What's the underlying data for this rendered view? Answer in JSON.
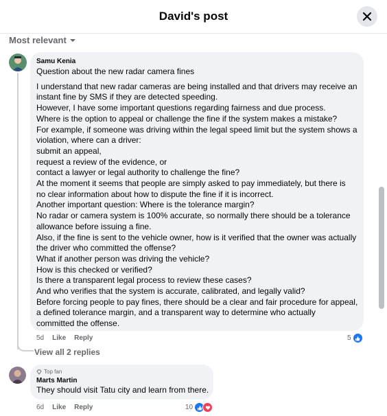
{
  "header": {
    "title": "David's post"
  },
  "sort": {
    "label": "Most relevant"
  },
  "comment1": {
    "author": "Samu Kenia",
    "lines": [
      "Question about the new radar camera fines",
      "",
      "I understand that new radar cameras are being installed and that drivers may receive an",
      "instant fine by SMS if they are detected speeding.",
      "However, I have some important questions regarding fairness and due process.",
      "Where is the option to appeal or challenge the fine if the system makes a mistake?",
      "For example, if someone was driving within the legal speed limit but the system shows a",
      "violation, where can a driver:",
      "submit an appeal,",
      "request a review of the evidence, or",
      "contact a lawyer or legal authority to challenge the fine?",
      "At the moment it seems that people are simply asked to pay immediately, but there is",
      "no clear information about how to dispute the fine if it is incorrect.",
      "Another important question: Where is the tolerance margin?",
      "No radar or camera system is 100% accurate, so normally there should be a tolerance",
      "allowance before issuing a fine.",
      "Also, if the fine is sent to the vehicle owner, how is it verified that the owner was actually",
      "the driver who committed the offense?",
      "What if another person was driving the vehicle?",
      "How is this checked or verified?",
      "Is there a transparent legal process to review these cases?",
      "And who verifies that the system is accurate, calibrated, and legally valid?",
      "Before forcing people to pay fines, there should be a clear and fair procedure for appeal,",
      "a defined tolerance margin, and a transparent way to determine who actually",
      "committed the offense."
    ],
    "time": "5d",
    "like": "Like",
    "reply": "Reply",
    "reaction_count": "5",
    "view_replies": "View all 2 replies"
  },
  "comment2": {
    "badge": "Top fan",
    "author": "Marts Martin",
    "text": "They should visit Tatu city and learn from there.",
    "time": "6d",
    "like": "Like",
    "reply": "Reply",
    "reaction_count": "10"
  },
  "colors": {
    "like_blue": "#1877f2",
    "love_red": "#f33e58",
    "meta_gray": "#65676b",
    "bubble": "#f0f2f5"
  }
}
